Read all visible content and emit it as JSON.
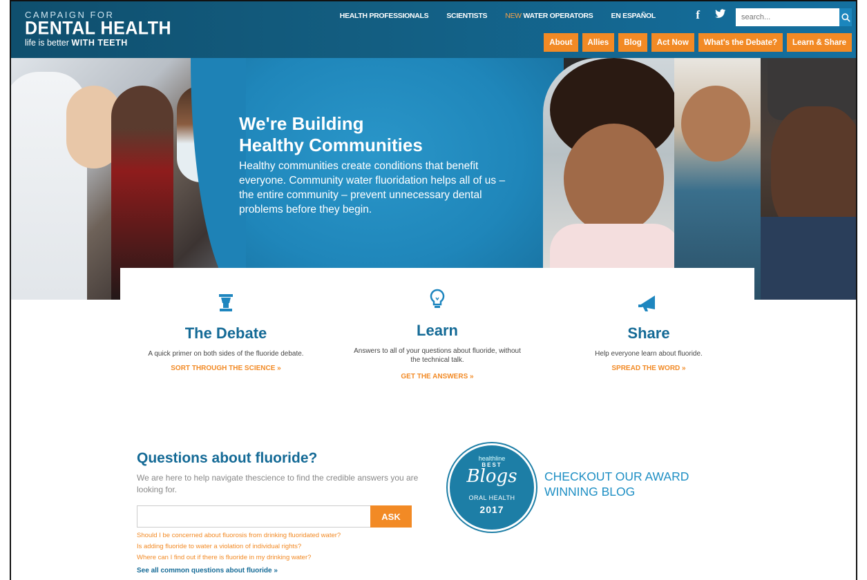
{
  "header": {
    "logo": {
      "line1": "CAMPAIGN FOR",
      "line2": "DENTAL HEALTH",
      "tagline_prefix": "life is better",
      "tagline_bold": "WITH TEETH"
    },
    "top_links": {
      "health_pros": "HEALTH PROFESSIONALS",
      "scientists": "SCIENTISTS",
      "new_label": "NEW",
      "water_operators": "WATER OPERATORS",
      "espanol": "EN ESPAÑOL"
    },
    "social": {
      "facebook": "f"
    },
    "search": {
      "placeholder": "search..."
    },
    "nav": {
      "about": "About",
      "allies": "Allies",
      "blog": "Blog",
      "act_now": "Act Now",
      "debate": "What's the Debate?",
      "learn_share": "Learn & Share"
    }
  },
  "hero": {
    "title_line1": "We're Building",
    "title_line2": "Healthy Communities",
    "body": "Healthy communities create conditions that benefit everyone. Community water fluoridation helps all of us – the entire community – prevent unnecessary dental problems before they begin."
  },
  "cards": [
    {
      "icon": "podium-icon",
      "title": "The Debate",
      "desc": "A quick primer on both sides of the fluoride debate.",
      "link": "SORT THROUGH THE SCIENCE »"
    },
    {
      "icon": "lightbulb-icon",
      "title": "Learn",
      "desc": "Answers to all of your questions about fluoride, without the technical talk.",
      "link": "GET THE ANSWERS »"
    },
    {
      "icon": "megaphone-icon",
      "title": "Share",
      "desc": "Help everyone learn about fluoride.",
      "link": "SPREAD THE WORD »"
    }
  ],
  "questions": {
    "title": "Questions about fluoride?",
    "intro": "We are here to help navigate thescience to find the credible answers you are looking for.",
    "input_value": "",
    "ask_label": "ASK",
    "links": [
      "Should I be concerned about fluorosis from drinking fluoridated water?",
      "Is adding fluoride to water a violation of individual rights?",
      "Where can I find out if there is fluoride in my drinking water?"
    ],
    "all_link": "See all common questions about fluoride »"
  },
  "award": {
    "badge": {
      "brand": "healthline",
      "best": "BEST",
      "blogs": "Blogs",
      "category": "ORAL HEALTH",
      "year": "2017"
    },
    "text": "CHECKOUT OUR AWARD WINNING BLOG"
  },
  "colors": {
    "primary_blue": "#146a96",
    "accent_orange": "#f28a25",
    "header_blue": "#135d80"
  }
}
